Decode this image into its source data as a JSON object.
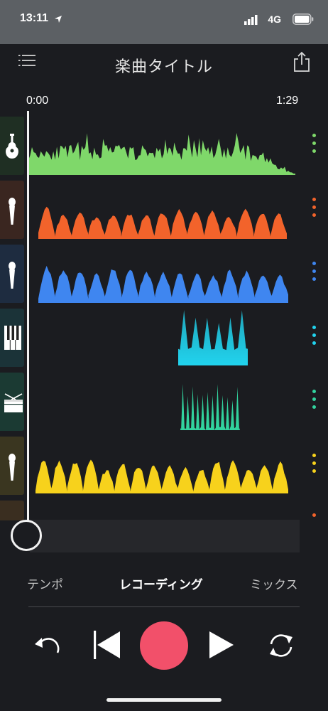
{
  "status_bar": {
    "time": "13:11",
    "network": "4G",
    "location_icon": "location-arrow-icon",
    "signal_icon": "cellular-signal-icon",
    "battery_icon": "battery-icon"
  },
  "header": {
    "title": "楽曲タイトル",
    "menu_icon": "list-menu-icon",
    "share_icon": "share-icon"
  },
  "timeline": {
    "start_time": "0:00",
    "end_time": "1:29"
  },
  "tracks": [
    {
      "instrument": "guitar",
      "icon": "guitar-icon",
      "color": "#7fd86a",
      "thumb_color": "#1f2f23"
    },
    {
      "instrument": "vocal",
      "icon": "microphone-icon",
      "color": "#f2632b",
      "thumb_color": "#3a2620"
    },
    {
      "instrument": "vocal",
      "icon": "microphone-icon",
      "color": "#3f86f0",
      "thumb_color": "#1e2c40"
    },
    {
      "instrument": "keyboard",
      "icon": "piano-keys-icon",
      "color": "#21d3ee",
      "thumb_color": "#1b3338"
    },
    {
      "instrument": "drums",
      "icon": "drum-icon",
      "color": "#32d39e",
      "thumb_color": "#1b3a33"
    },
    {
      "instrument": "vocal",
      "icon": "microphone-icon",
      "color": "#f7d21c",
      "thumb_color": "#3a3620"
    }
  ],
  "tabs": [
    {
      "label": "テンポ",
      "active": false
    },
    {
      "label": "レコーディング",
      "active": true
    },
    {
      "label": "ミックス",
      "active": false
    }
  ],
  "transport": {
    "undo_icon": "undo-icon",
    "rewind_icon": "skip-to-start-icon",
    "record_icon": "record-button",
    "play_icon": "play-icon",
    "loop_icon": "loop-icon",
    "record_color": "#f2506a"
  }
}
